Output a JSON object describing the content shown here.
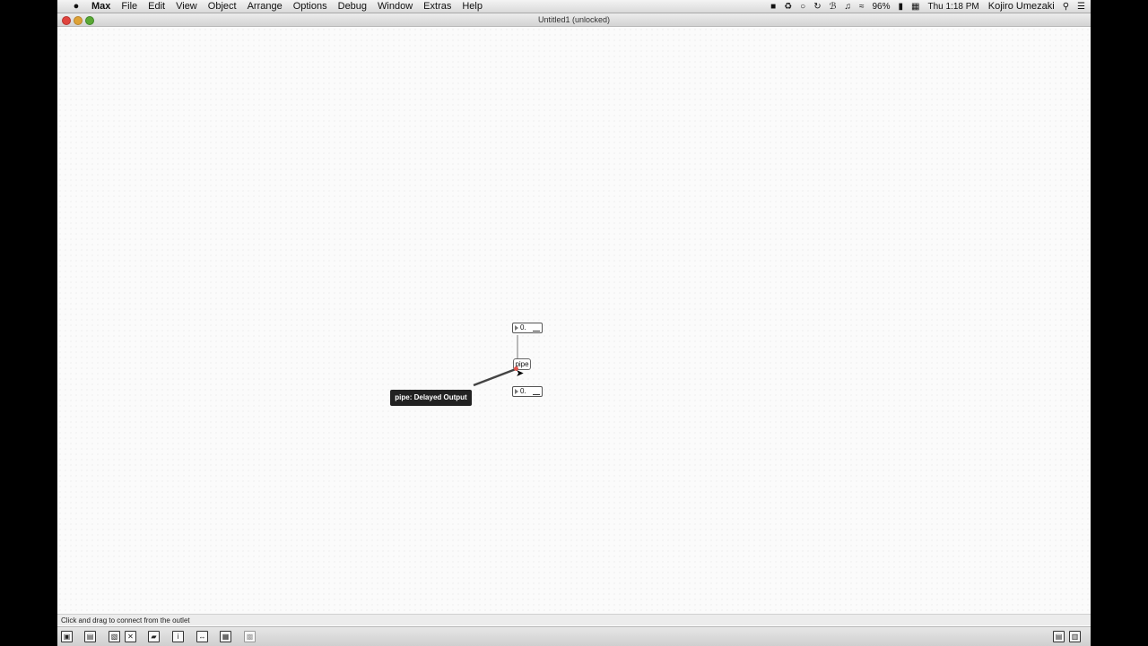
{
  "menubar": {
    "apple_glyph": "",
    "app_name": "Max",
    "menus": [
      "File",
      "Edit",
      "View",
      "Object",
      "Arrange",
      "Options",
      "Debug",
      "Window",
      "Extras",
      "Help"
    ],
    "battery": "96%",
    "clock": "Thu 1:18 PM",
    "user": "Kojiro Umezaki"
  },
  "window": {
    "title": "Untitled1 (unlocked)"
  },
  "patch": {
    "number_top": "0.",
    "object_label": "pipe",
    "number_bottom": "0.",
    "tooltip": "pipe: Delayed Output"
  },
  "status_text": "Click and drag to connect from the outlet",
  "colors": {
    "close": "#e0443e",
    "minimize": "#dea236",
    "zoom": "#5aa834",
    "outlet_highlight": "#e0524b"
  }
}
